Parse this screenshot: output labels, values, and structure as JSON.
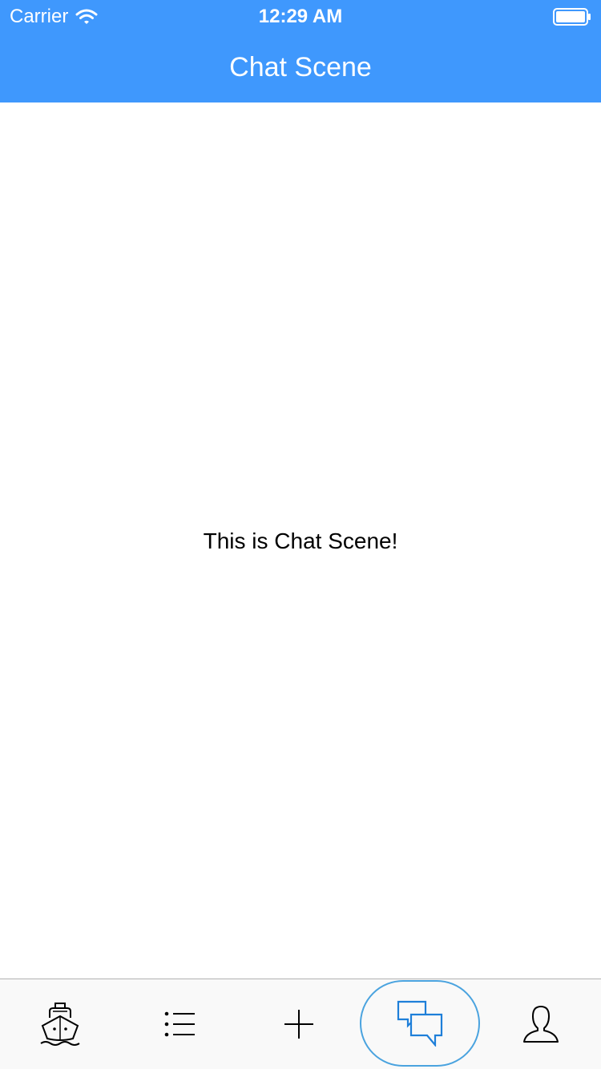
{
  "status_bar": {
    "carrier": "Carrier",
    "time": "12:29 AM"
  },
  "nav": {
    "title": "Chat Scene"
  },
  "main": {
    "message": "This is Chat Scene!"
  },
  "tabbar": {
    "tabs": [
      {
        "icon": "ship-icon",
        "active": false
      },
      {
        "icon": "list-icon",
        "active": false
      },
      {
        "icon": "plus-icon",
        "active": false
      },
      {
        "icon": "chat-bubbles-icon",
        "active": true
      },
      {
        "icon": "user-icon",
        "active": false
      }
    ]
  },
  "colors": {
    "header_bg": "#3f98fd",
    "active_tab": "#1e7fd9",
    "active_ring": "#4aa3df"
  }
}
